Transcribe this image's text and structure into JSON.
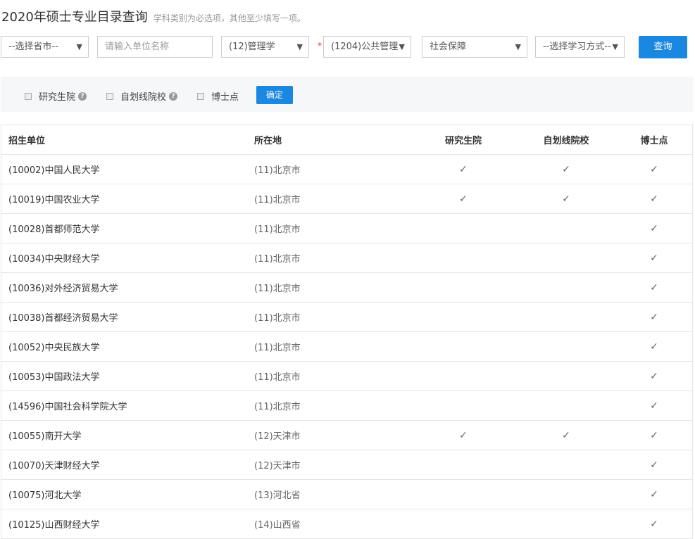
{
  "title": "2020年硕士专业目录查询",
  "hint": "学科类别为必选项，其他至少填写一项。",
  "filters": {
    "province": "--选择省市--",
    "unit_placeholder": "请输入单位名称",
    "category": "(12)管理学",
    "discipline": "(1204)公共管理",
    "major": "社会保障",
    "study_mode": "--选择学习方式--",
    "search": "查询"
  },
  "options": {
    "grad_school": "研究生院",
    "self_line": "自划线院校",
    "phd": "博士点",
    "confirm": "确定"
  },
  "table": {
    "headers": [
      "招生单位",
      "所在地",
      "研究生院",
      "自划线院校",
      "博士点"
    ],
    "rows": [
      [
        "(10002)中国人民大学",
        "(11)北京市",
        true,
        true,
        true
      ],
      [
        "(10019)中国农业大学",
        "(11)北京市",
        true,
        true,
        true
      ],
      [
        "(10028)首都师范大学",
        "(11)北京市",
        false,
        false,
        true
      ],
      [
        "(10034)中央财经大学",
        "(11)北京市",
        false,
        false,
        true
      ],
      [
        "(10036)对外经济贸易大学",
        "(11)北京市",
        false,
        false,
        true
      ],
      [
        "(10038)首都经济贸易大学",
        "(11)北京市",
        false,
        false,
        true
      ],
      [
        "(10052)中央民族大学",
        "(11)北京市",
        false,
        false,
        true
      ],
      [
        "(10053)中国政法大学",
        "(11)北京市",
        false,
        false,
        true
      ],
      [
        "(14596)中国社会科学院大学",
        "(11)北京市",
        false,
        false,
        true
      ],
      [
        "(10055)南开大学",
        "(12)天津市",
        true,
        true,
        true
      ],
      [
        "(10070)天津财经大学",
        "(12)天津市",
        false,
        false,
        true
      ],
      [
        "(10075)河北大学",
        "(13)河北省",
        false,
        false,
        true
      ],
      [
        "(10125)山西财经大学",
        "(14)山西省",
        false,
        false,
        true
      ]
    ]
  }
}
